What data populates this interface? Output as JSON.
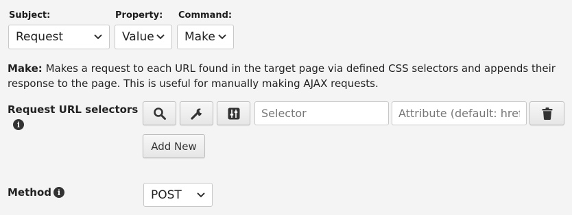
{
  "top": {
    "subject": {
      "label": "Subject:",
      "value": "Request"
    },
    "property": {
      "label": "Property:",
      "value": "Value"
    },
    "command": {
      "label": "Command:",
      "value": "Make"
    }
  },
  "description": {
    "term": "Make:",
    "text": " Makes a request to each URL found in the target page via defined CSS selectors and appends their response to the page. This is useful for manually making AJAX requests."
  },
  "selectors": {
    "label": "Request URL selectors",
    "icons": [
      "search-icon",
      "wrench-icon",
      "adjust-icon",
      "trash-icon"
    ],
    "selector_placeholder": "Selector",
    "attribute_placeholder": "Attribute (default: href)",
    "add_new_label": "Add New"
  },
  "method": {
    "label": "Method",
    "value": "POST"
  },
  "info_glyph": "i"
}
